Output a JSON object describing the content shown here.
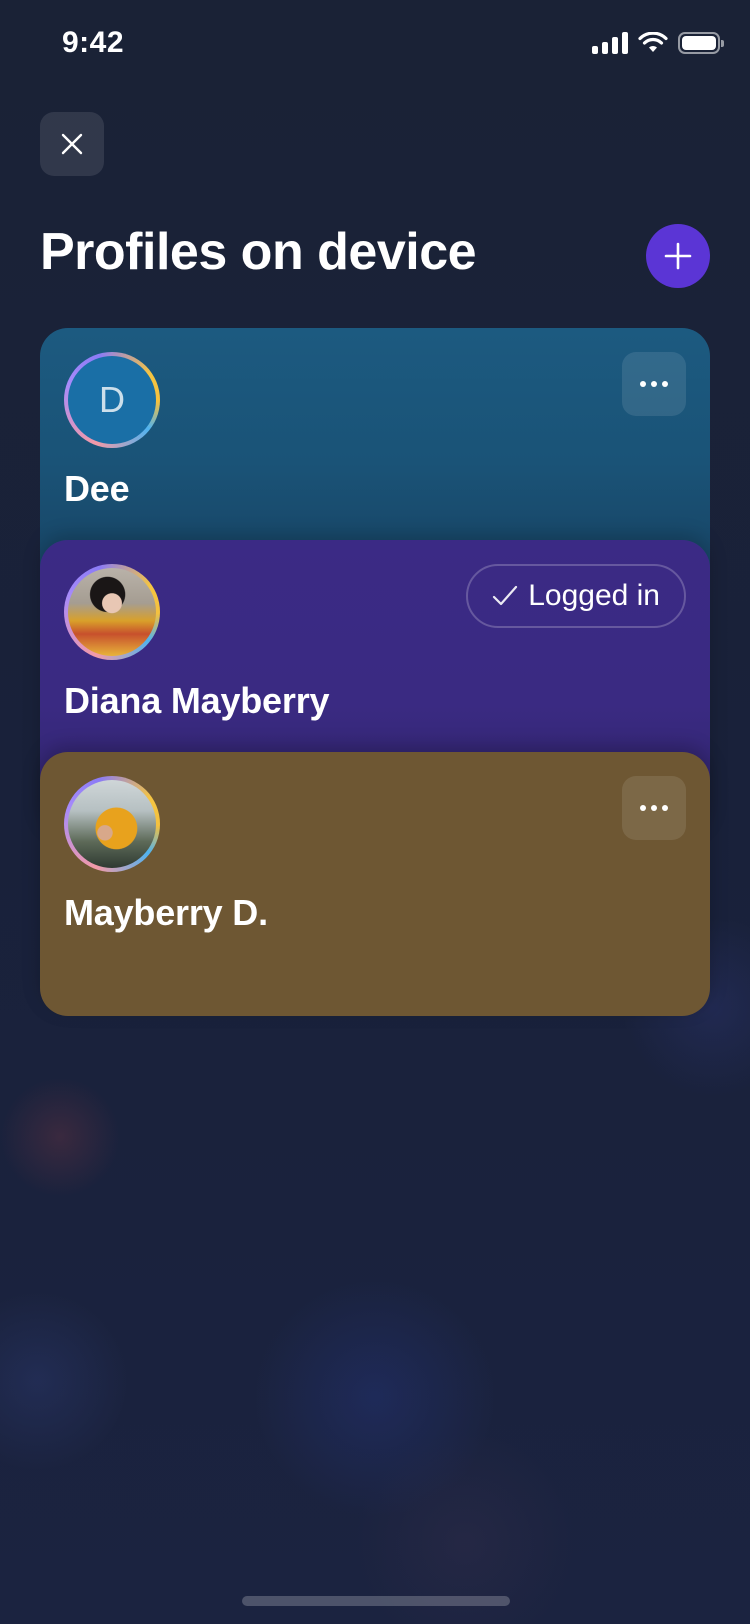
{
  "status_bar": {
    "time": "9:42"
  },
  "header": {
    "title": "Profiles on device"
  },
  "profiles": [
    {
      "name": "Dee",
      "avatar_letter": "D",
      "avatar_type": "letter",
      "card_color": "#1c5a80",
      "action_icon": "more-icon"
    },
    {
      "name": "Diana Mayberry",
      "avatar_type": "photo",
      "card_color": "#3b2a85",
      "badge": "Logged in",
      "badge_icon": "check-icon"
    },
    {
      "name": "Mayberry D.",
      "avatar_type": "photo",
      "card_color": "#6e5733",
      "action_icon": "more-icon"
    }
  ],
  "colors": {
    "accent": "#5b35d5",
    "background": "#1a2238"
  }
}
